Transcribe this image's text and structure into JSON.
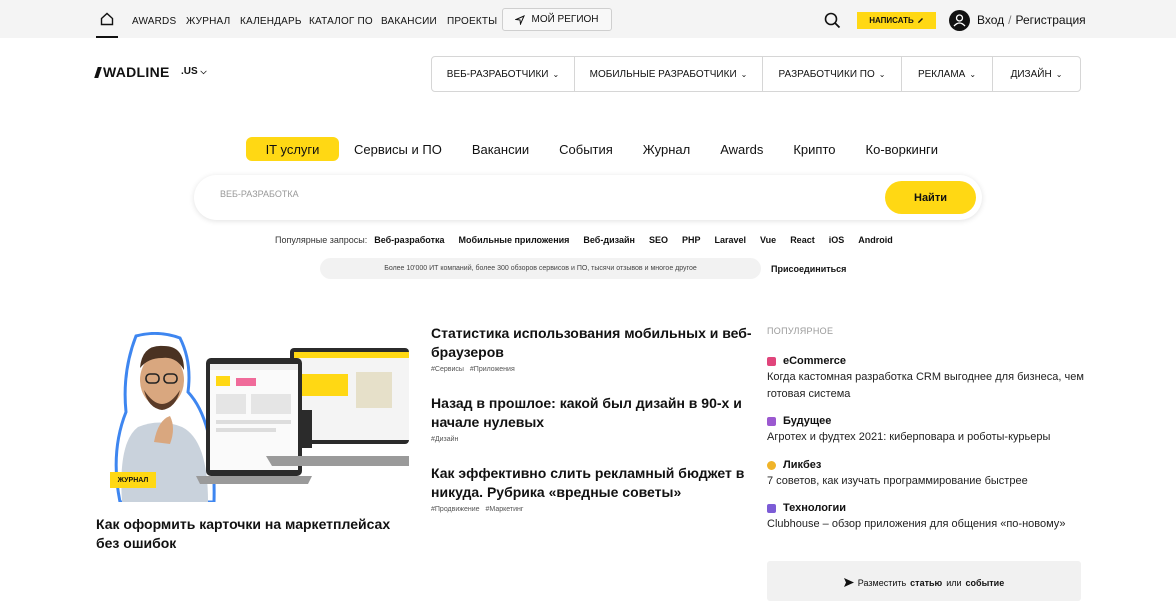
{
  "topbar": {
    "nav": [
      "AWARDS",
      "ЖУРНАЛ",
      "КАЛЕНДАРЬ",
      "КАТАЛОГ ПО",
      "ВАКАНСИИ",
      "ПРОЕКТЫ"
    ],
    "region_label": "МОЙ РЕГИОН",
    "write_label": "НАПИСАТЬ",
    "login_label": "Вход",
    "register_label": "Регистрация",
    "separator": "/"
  },
  "header": {
    "logo": "WADLINE",
    "locale": ".US",
    "categories": [
      "ВЕБ-РАЗРАБОТЧИКИ",
      "МОБИЛЬНЫЕ РАЗРАБОТЧИКИ",
      "РАЗРАБОТЧИКИ ПО",
      "РЕКЛАМА",
      "ДИЗАЙН"
    ]
  },
  "tabs": [
    "IT услуги",
    "Сервисы и ПО",
    "Вакансии",
    "События",
    "Журнал",
    "Awards",
    "Крипто",
    "Ко-воркинги"
  ],
  "search": {
    "placeholder": "ВЕБ-РАЗРАБОТКА",
    "button": "Найти"
  },
  "popular_queries": {
    "label": "Популярные запросы:",
    "items": [
      "Веб-разработка",
      "Мобильные приложения",
      "Веб-дизайн",
      "SEO",
      "PHP",
      "Laravel",
      "Vue",
      "React",
      "iOS",
      "Android"
    ]
  },
  "join": {
    "text": "Более 10'000 ИТ компаний, более 300 обзоров сервисов и ПО, тысячи отзывов и многое другое",
    "link": "Присоединиться"
  },
  "featured": {
    "badge": "ЖУРНАЛ",
    "title": "Как оформить карточки на маркетплейсах без ошибок"
  },
  "articles": [
    {
      "title": "Статистика использования мобильных и веб-браузеров",
      "tags": [
        "#Сервисы",
        "#Приложения"
      ]
    },
    {
      "title": "Назад в прошлое: какой был дизайн в 90-х и начале нулевых",
      "tags": [
        "#Дизайн"
      ]
    },
    {
      "title": "Как эффективно слить рекламный бюджет в никуда. Рубрика «вредные советы»",
      "tags": [
        "#Продвижение",
        "#Маркетинг"
      ]
    }
  ],
  "popular": {
    "heading": "ПОПУЛЯРНОЕ",
    "items": [
      {
        "category": "eCommerce",
        "text": "Когда кастомная разработка CRM выгоднее для бизнеса, чем готовая система",
        "color": "#e0457b"
      },
      {
        "category": "Будущее",
        "text": "Агротех и фудтех 2021: киберповара и роботы-курьеры",
        "color": "#9b59d0"
      },
      {
        "category": "Ликбез",
        "text": "7 советов, как изучать программирование быстрее",
        "color": "#f0b429"
      },
      {
        "category": "Технологии",
        "text": "Clubhouse – обзор приложения для общения «по-новому»",
        "color": "#7c5cd6"
      }
    ]
  },
  "place": {
    "prefix": "Разместить",
    "article": "статью",
    "or": "или",
    "event": "событие"
  },
  "colors": {
    "accent": "#ffd814",
    "topbar_bg": "#f4f4f4"
  }
}
